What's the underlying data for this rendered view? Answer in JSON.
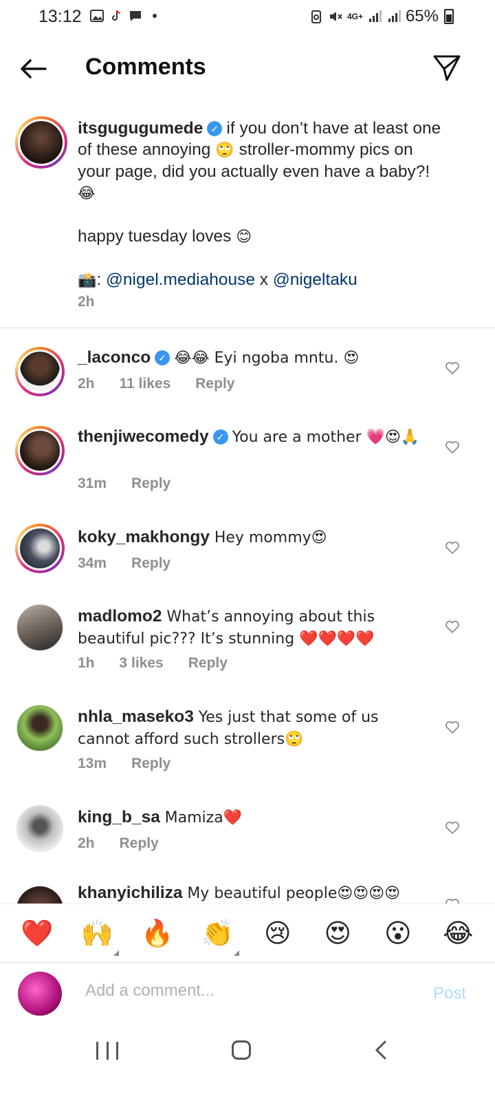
{
  "status_bar": {
    "time": "13:12",
    "network": "4G+",
    "battery": "65%"
  },
  "header": {
    "title": "Comments"
  },
  "caption": {
    "username": "itsgugugumede",
    "verified": true,
    "text_line1": "if you don’t have at least one of these annoying",
    "emoji1": "🙄",
    "text_line2": "stroller-mommy pics on your page, did you actually even have a baby?!",
    "emoji2": "😂",
    "text_line3": "happy tuesday loves",
    "emoji3": "😊",
    "camera_emoji": "📸",
    "mention1": "@nigel.mediahouse",
    "joiner": "x",
    "mention2": "@nigeltaku",
    "time": "2h"
  },
  "comments": [
    {
      "username": "_laconco",
      "verified": true,
      "text": "😂😂 Eyi ngoba mntu. 😍",
      "time": "2h",
      "likes": "11 likes",
      "reply": "Reply",
      "avatar_color": "#2b2b2b"
    },
    {
      "username": "thenjiwecomedy",
      "verified": true,
      "text": "You are a mother 💗😍🙏",
      "time": "31m",
      "likes": "",
      "reply": "Reply",
      "avatar_color": "#3a2a24"
    },
    {
      "username": "koky_makhongy",
      "verified": false,
      "text": "Hey mommy😍",
      "time": "34m",
      "likes": "",
      "reply": "Reply",
      "avatar_color": "#4a5060"
    },
    {
      "username": "madlomo2",
      "verified": false,
      "text": "What’s annoying about this beautiful pic??? It’s stunning ❤️❤️❤️❤️",
      "time": "1h",
      "likes": "3 likes",
      "reply": "Reply",
      "avatar_color": "#9a8f86"
    },
    {
      "username": "nhla_maseko3",
      "verified": false,
      "text": "Yes just that some of us cannot afford such strollers🙄",
      "time": "13m",
      "likes": "",
      "reply": "Reply",
      "avatar_color": "#6b8f4a"
    },
    {
      "username": "king_b_sa",
      "verified": false,
      "text": "Mamiza❤️",
      "time": "2h",
      "likes": "",
      "reply": "Reply",
      "avatar_color": "#c9c9c9"
    },
    {
      "username": "khanyichiliza",
      "verified": false,
      "text": "My beautiful people😍😍😍😍",
      "time": "",
      "likes": "",
      "reply": "",
      "avatar_color": "#5a3b34"
    }
  ],
  "reactions": [
    "❤️",
    "🙌",
    "🔥",
    "👏",
    "😢",
    "😍",
    "😮",
    "😂"
  ],
  "compose": {
    "placeholder": "Add a comment...",
    "post_label": "Post"
  },
  "colors": {
    "verified_blue": "#3897f0",
    "mention_blue": "#00376b",
    "post_disabled": "#b3dbff"
  }
}
